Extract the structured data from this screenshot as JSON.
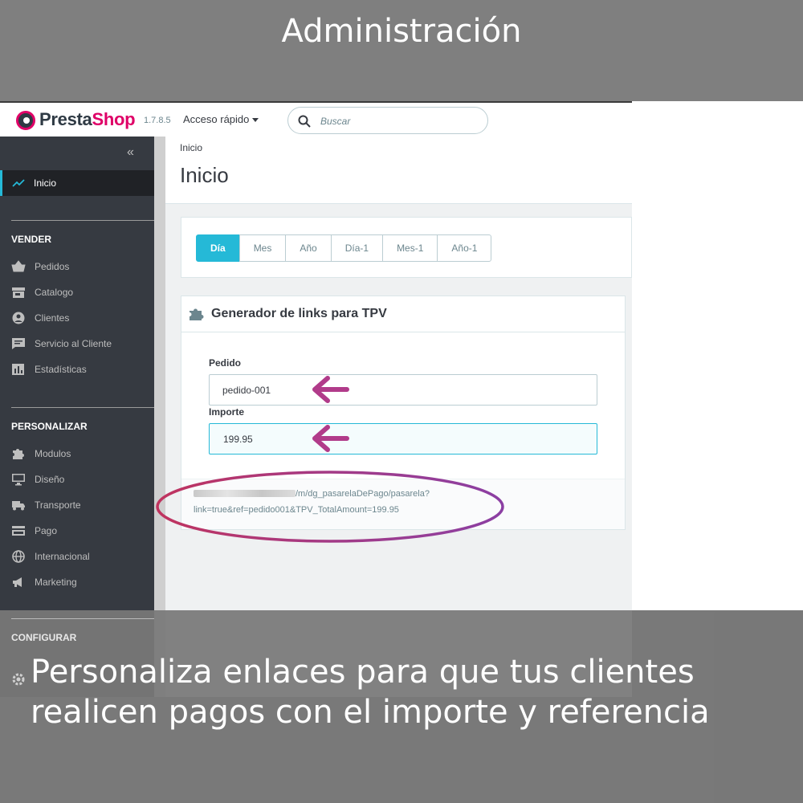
{
  "banner": {
    "title": "Administración"
  },
  "header": {
    "logo_prefix": "Presta",
    "logo_suffix": "Shop",
    "version": "1.7.8.5",
    "quick_access": "Acceso rápido",
    "search_placeholder": "Buscar"
  },
  "sidebar": {
    "active": "Inicio",
    "sections": [
      {
        "title": "VENDER",
        "items": [
          "Pedidos",
          "Catalogo",
          "Clientes",
          "Servicio al Cliente",
          "Estadísticas"
        ]
      },
      {
        "title": "PERSONALIZAR",
        "items": [
          "Modulos",
          "Diseño",
          "Transporte",
          "Pago",
          "Internacional",
          "Marketing"
        ]
      },
      {
        "title": "CONFIGURAR"
      }
    ]
  },
  "page": {
    "breadcrumb": "Inicio",
    "title": "Inicio"
  },
  "periods": [
    "Día",
    "Mes",
    "Año",
    "Día-1",
    "Mes-1",
    "Año-1"
  ],
  "generator": {
    "title": "Generador de links para TPV",
    "order_label": "Pedido",
    "order_value": "pedido-001",
    "amount_label": "Importe",
    "amount_value": "199.95",
    "link_line1": "/m/dg_pasarelaDePago/pasarela?",
    "link_line2": "link=true&ref=pedido001&TPV_TotalAmount=199.95"
  },
  "caption": "Personaliza enlaces para que tus clientes realicen pagos con el importe y referencia",
  "colors": {
    "accent": "#25b9d7",
    "brand": "#df0067",
    "sidebar": "#363a41",
    "arrow": "#b13b8a"
  }
}
